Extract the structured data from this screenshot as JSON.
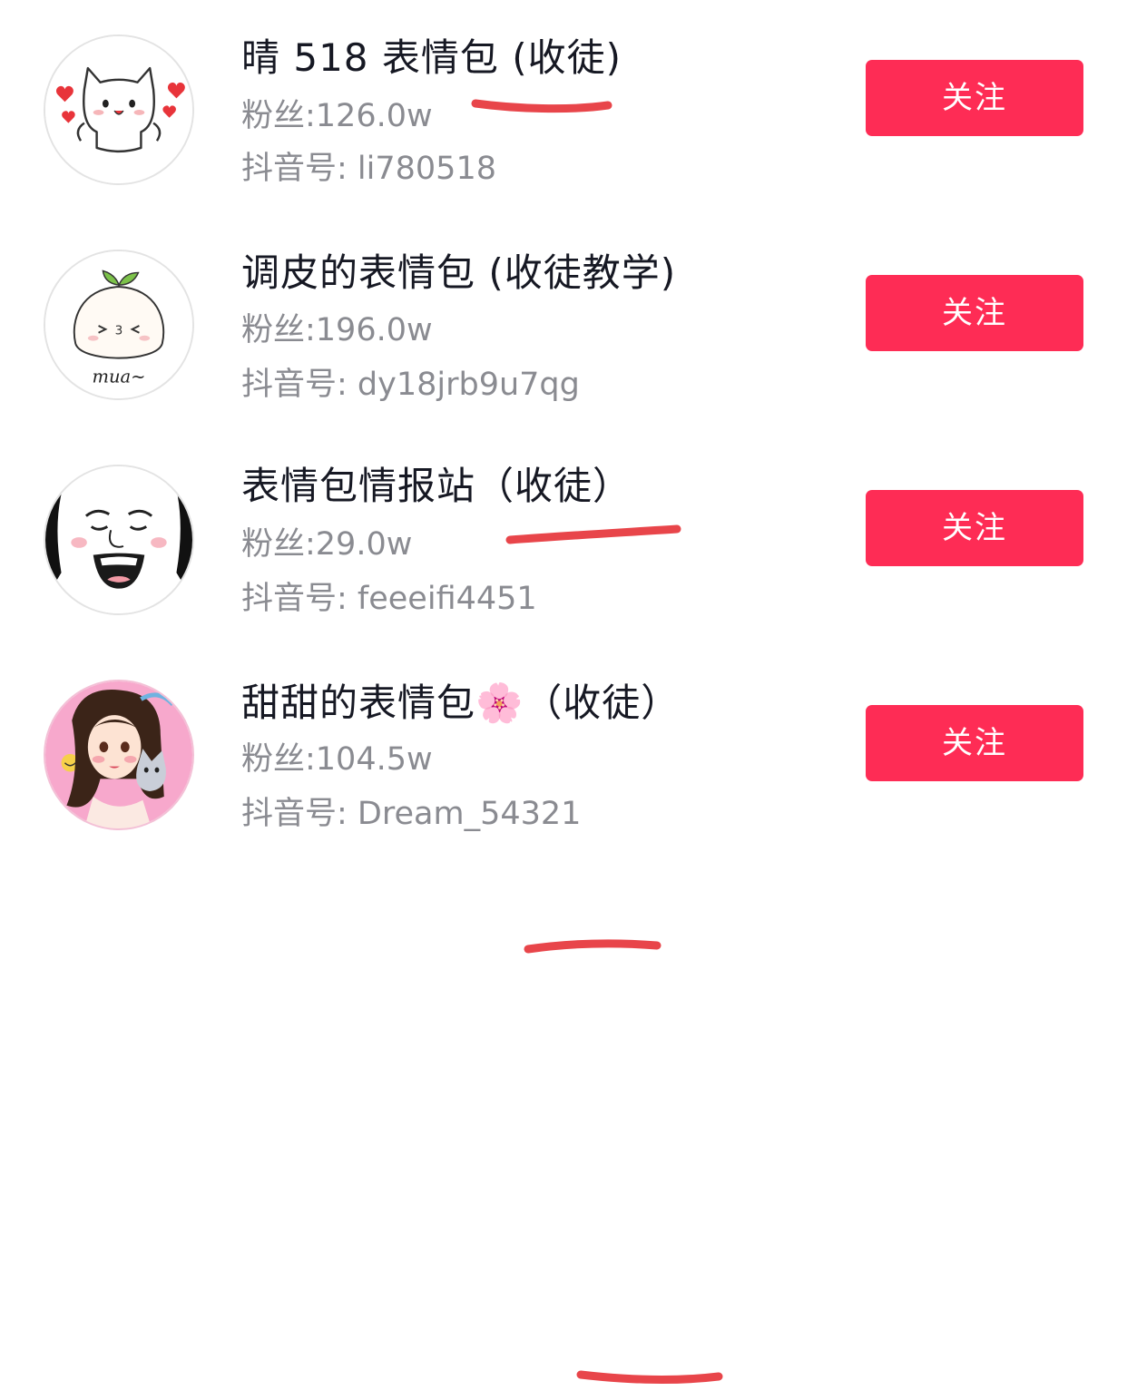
{
  "accent_color": "#fe2c55",
  "annotation_color": "#e8454a",
  "accounts": [
    {
      "name": "晴 518 表情包 (收徒)",
      "fans": "粉丝:126.0w",
      "uid": "抖音号: li780518",
      "follow_label": "关注",
      "avatar_icon": "white-cat-hearts-avatar"
    },
    {
      "name": "调皮的表情包 (收徒教学)",
      "fans": "粉丝:196.0w",
      "uid": "抖音号: dy18jrb9u7qg",
      "follow_label": "关注",
      "avatar_icon": "sprout-blob-mua-avatar",
      "avatar_text": "mua~"
    },
    {
      "name": "表情包情报站（收徒）",
      "fans": "粉丝:29.0w",
      "uid": "抖音号: feeeifi4451",
      "follow_label": "关注",
      "avatar_icon": "panda-face-meme-avatar"
    },
    {
      "name": "甜甜的表情包🌸（收徒）",
      "fans": "粉丝:104.5w",
      "uid": "抖音号: Dream_54321",
      "follow_label": "关注",
      "avatar_icon": "girl-with-cat-avatar"
    }
  ]
}
